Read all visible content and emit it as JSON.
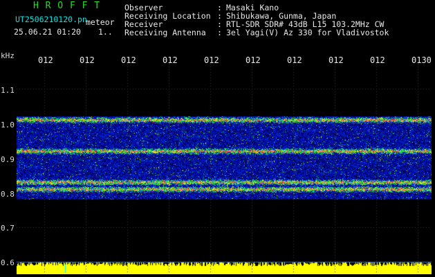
{
  "header": {
    "brand": "H R O F F T",
    "file_name": "UT2506210120.pn",
    "mode": "meteor",
    "datetime": "25.06.21 01:20",
    "counter": "1..",
    "observer_label": "Observer",
    "observer_value": "Masaki Kano",
    "location_label": "Receiving Location",
    "location_value": "Shibukawa, Gunma, Japan",
    "receiver_label": "Receiver",
    "receiver_value": "RTL-SDR SDR# 43dB L15 103.2MHz CW",
    "antenna_label": "Receiving Antenna",
    "antenna_value": "3el Yagi(V) Az 330 for Vladivostok",
    "sep": ":"
  },
  "spectrogram": {
    "y_unit": "kHz",
    "y_ticks": [
      "1.1",
      "1.0",
      "0.9",
      "0.8",
      "0.7",
      "0.6"
    ],
    "x_ticks": [
      "012",
      "012",
      "012",
      "012",
      "012",
      "012",
      "012",
      "012",
      "012",
      "0130"
    ],
    "y_range": [
      0.6,
      1.15
    ],
    "signal_start_khz": 1.02,
    "signal_end_khz": 0.78,
    "bright_lines_khz": [
      1.01,
      0.92,
      0.83,
      0.81
    ],
    "colors": {
      "bg": "#000033",
      "noise": "#0000cc",
      "hot": "#ff3040",
      "level": "#ffff00"
    }
  }
}
